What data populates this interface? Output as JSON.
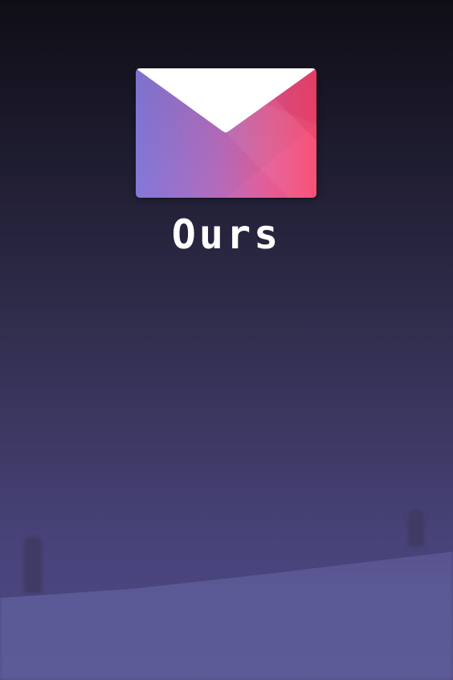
{
  "app": {
    "name": "Ours",
    "logo_icon": "envelope-icon",
    "colors": {
      "logo_gradient_start": "#8a7fe6",
      "logo_gradient_end": "#f8476e",
      "background_top": "#0f0e16",
      "background_bottom": "#5d5b97"
    }
  }
}
